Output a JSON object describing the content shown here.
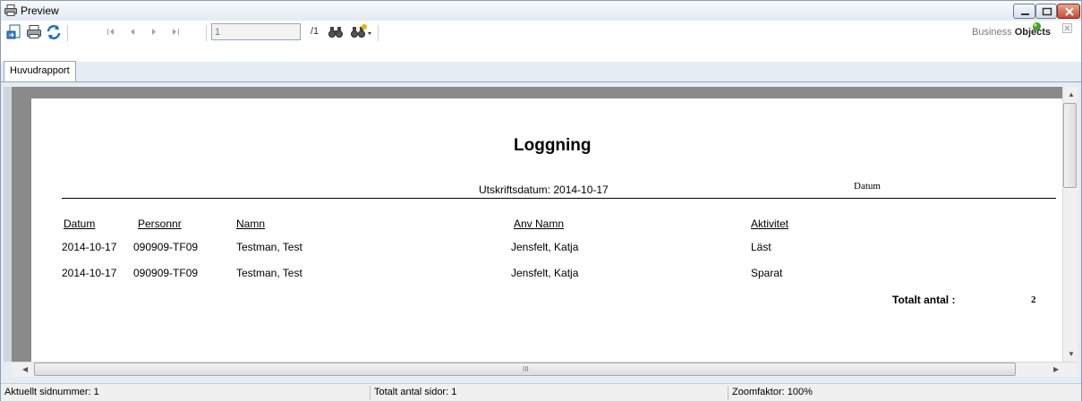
{
  "window": {
    "title": "Preview",
    "icon": "printer-icon"
  },
  "toolbar": {
    "page_input_value": "1",
    "page_total": "/1",
    "logo_prefix": "Business ",
    "logo_bold": "Objects"
  },
  "tabs": [
    {
      "label": "Huvudrapport"
    }
  ],
  "report": {
    "title": "Loggning",
    "print_date": "Utskriftsdatum: 2014-10-17",
    "datum_label": "Datum",
    "columns": [
      "Datum",
      "Personnr",
      "Namn",
      "Anv Namn",
      "Aktivitet"
    ],
    "rows": [
      [
        "2014-10-17",
        "090909-TF09",
        "Testman, Test",
        "Jensfelt, Katja",
        "Läst"
      ],
      [
        "2014-10-17",
        "090909-TF09",
        "Testman, Test",
        "Jensfelt, Katja",
        "Sparat"
      ]
    ],
    "total_label": "Totalt antal :",
    "total_value": "2"
  },
  "scrollbar": {
    "grip": "III"
  },
  "status": {
    "current_page": "Aktuellt sidnummer: 1",
    "total_pages": "Totalt antal sidor: 1",
    "zoom": "Zoomfaktor: 100%"
  },
  "colors": {
    "viewport_bg": "#8a8a8a",
    "close_button": "#c84a31",
    "window_border": "#8a9bb3"
  }
}
